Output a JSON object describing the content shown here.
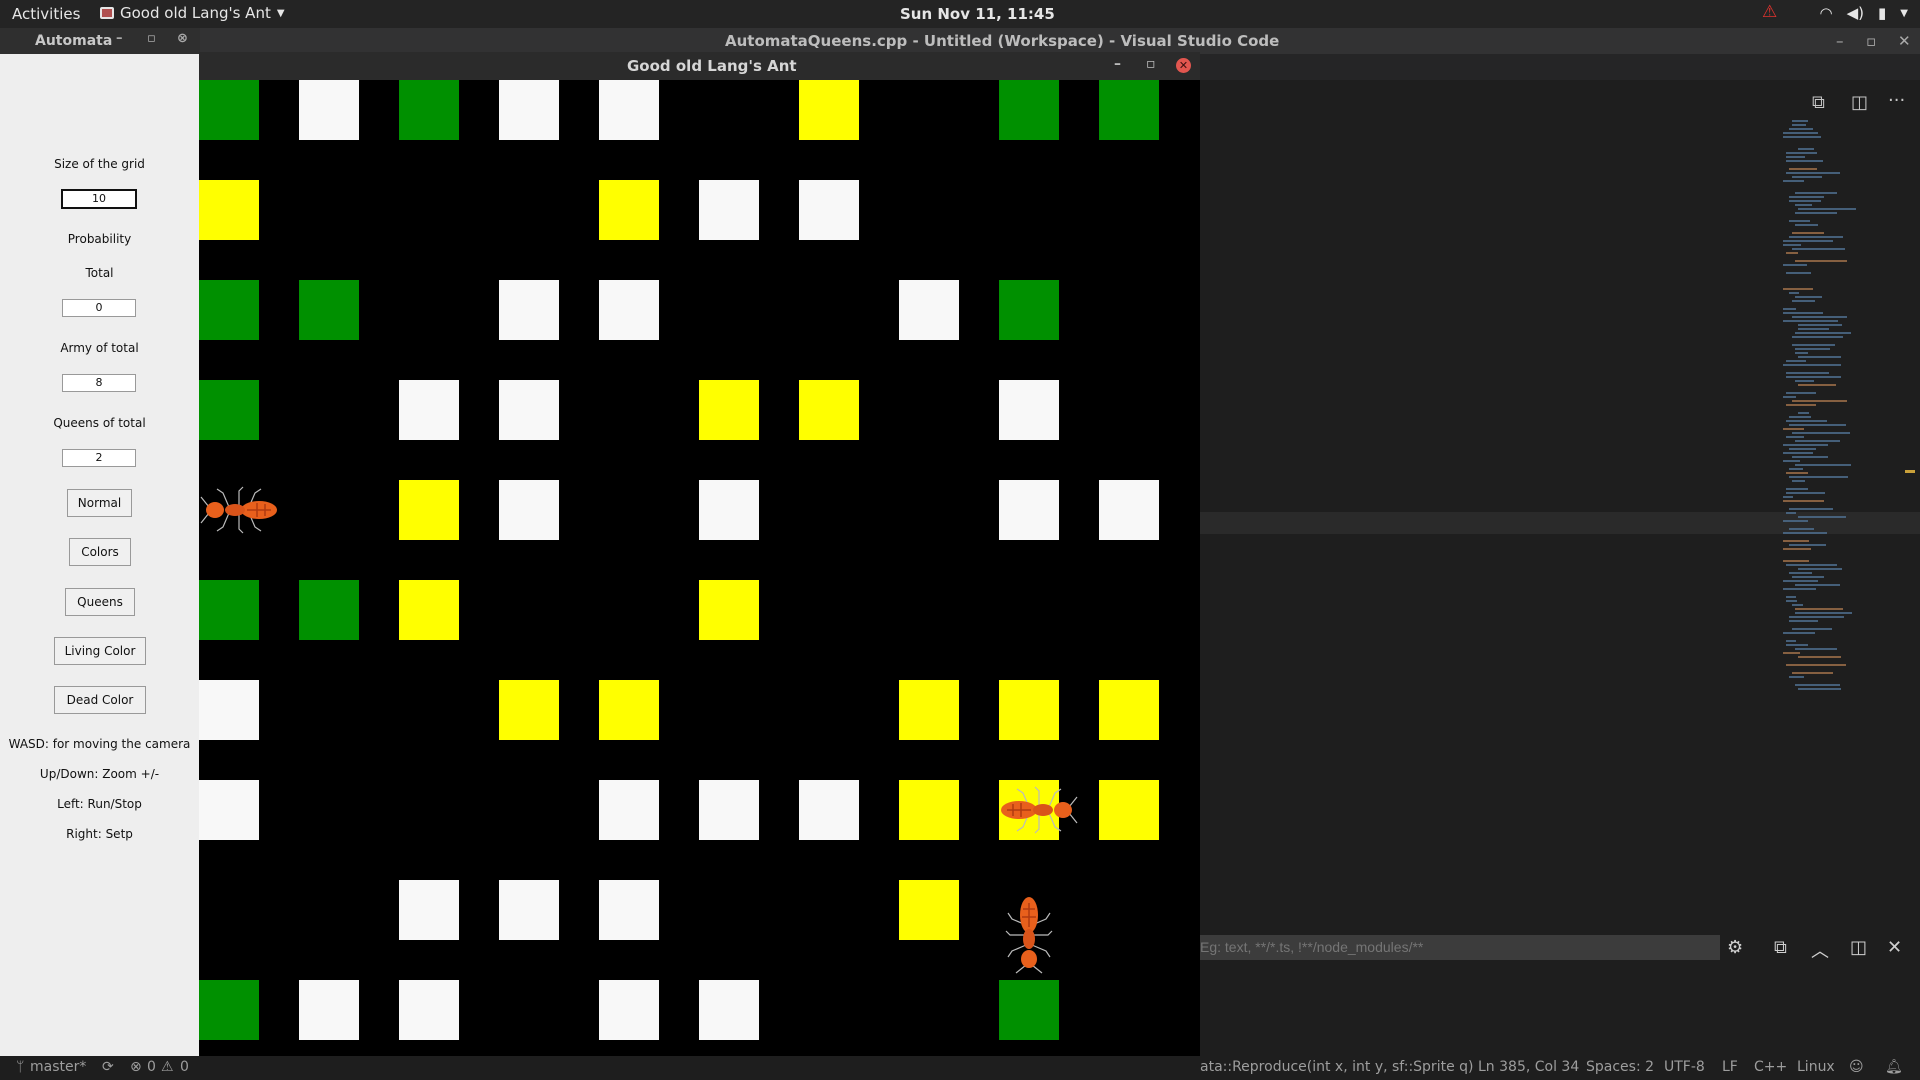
{
  "topbar": {
    "activities": "Activities",
    "app_name": "Good old Lang's Ant",
    "clock": "Sun Nov 11, 11:45"
  },
  "vscode": {
    "window_title": "AutomataQueens.cpp - Untitled (Workspace) - Visual Studio Code",
    "filter_placeholder": "Eg: text, **/*.ts, !**/node_modules/**"
  },
  "statusbar": {
    "branch": "master*",
    "errors": "0",
    "warnings": "0",
    "breadcrumb": "ata::Reproduce(int x, int y, sf::Sprite q)",
    "position": "Ln 385, Col 34",
    "spaces": "Spaces: 2",
    "encoding": "UTF-8",
    "eol": "LF",
    "language": "C++",
    "os": "Linux"
  },
  "automata": {
    "window_title": "Automata",
    "labels": {
      "grid_size": "Size of the grid",
      "probability": "Probability",
      "total": "Total",
      "army": "Army of total",
      "queens": "Queens of total"
    },
    "values": {
      "grid_size": "10",
      "total": "0",
      "army": "8",
      "queens": "2"
    },
    "buttons": {
      "normal": "Normal",
      "colors": "Colors",
      "queens": "Queens",
      "living_color": "Living Color",
      "dead_color": "Dead Color"
    },
    "help": {
      "wasd": "WASD: for moving the camera",
      "updown": "Up/Down: Zoom +/-",
      "left": "Left: Run/Stop",
      "right": "Right: Setp"
    }
  },
  "ant_window": {
    "title": "Good old Lang's Ant",
    "colors": {
      "g": "#009000",
      "w": "#f8f8f8",
      "y": "#ffff00"
    },
    "grid": [
      [
        "g",
        "w",
        "g",
        "w",
        "w",
        ".",
        "y",
        ".",
        "g",
        "g"
      ],
      [
        "y",
        ".",
        ".",
        ".",
        "y",
        "w",
        "w",
        ".",
        ".",
        "."
      ],
      [
        "g",
        "g",
        ".",
        "w",
        "w",
        ".",
        ".",
        "w",
        "g",
        "."
      ],
      [
        "g",
        ".",
        "w",
        "w",
        ".",
        "y",
        "y",
        ".",
        "w",
        "."
      ],
      [
        ".",
        ".",
        "y",
        "w",
        ".",
        "w",
        ".",
        ".",
        "w",
        "w"
      ],
      [
        "g",
        "g",
        "y",
        ".",
        ".",
        "y",
        ".",
        ".",
        ".",
        "."
      ],
      [
        "w",
        ".",
        ".",
        "y",
        "y",
        ".",
        ".",
        "y",
        "y",
        "y"
      ],
      [
        "w",
        ".",
        ".",
        ".",
        "w",
        "w",
        "w",
        "y",
        "y",
        "y"
      ],
      [
        ".",
        ".",
        "w",
        "w",
        "w",
        ".",
        ".",
        "y",
        ".",
        "."
      ],
      [
        "g",
        "w",
        "w",
        ".",
        "w",
        "w",
        ".",
        ".",
        "g",
        "."
      ]
    ],
    "ants": [
      {
        "row": 4,
        "col": 0,
        "facing": "left"
      },
      {
        "row": 7,
        "col": 8,
        "facing": "right"
      },
      {
        "row": 8,
        "col": 8,
        "facing": "down"
      }
    ]
  }
}
